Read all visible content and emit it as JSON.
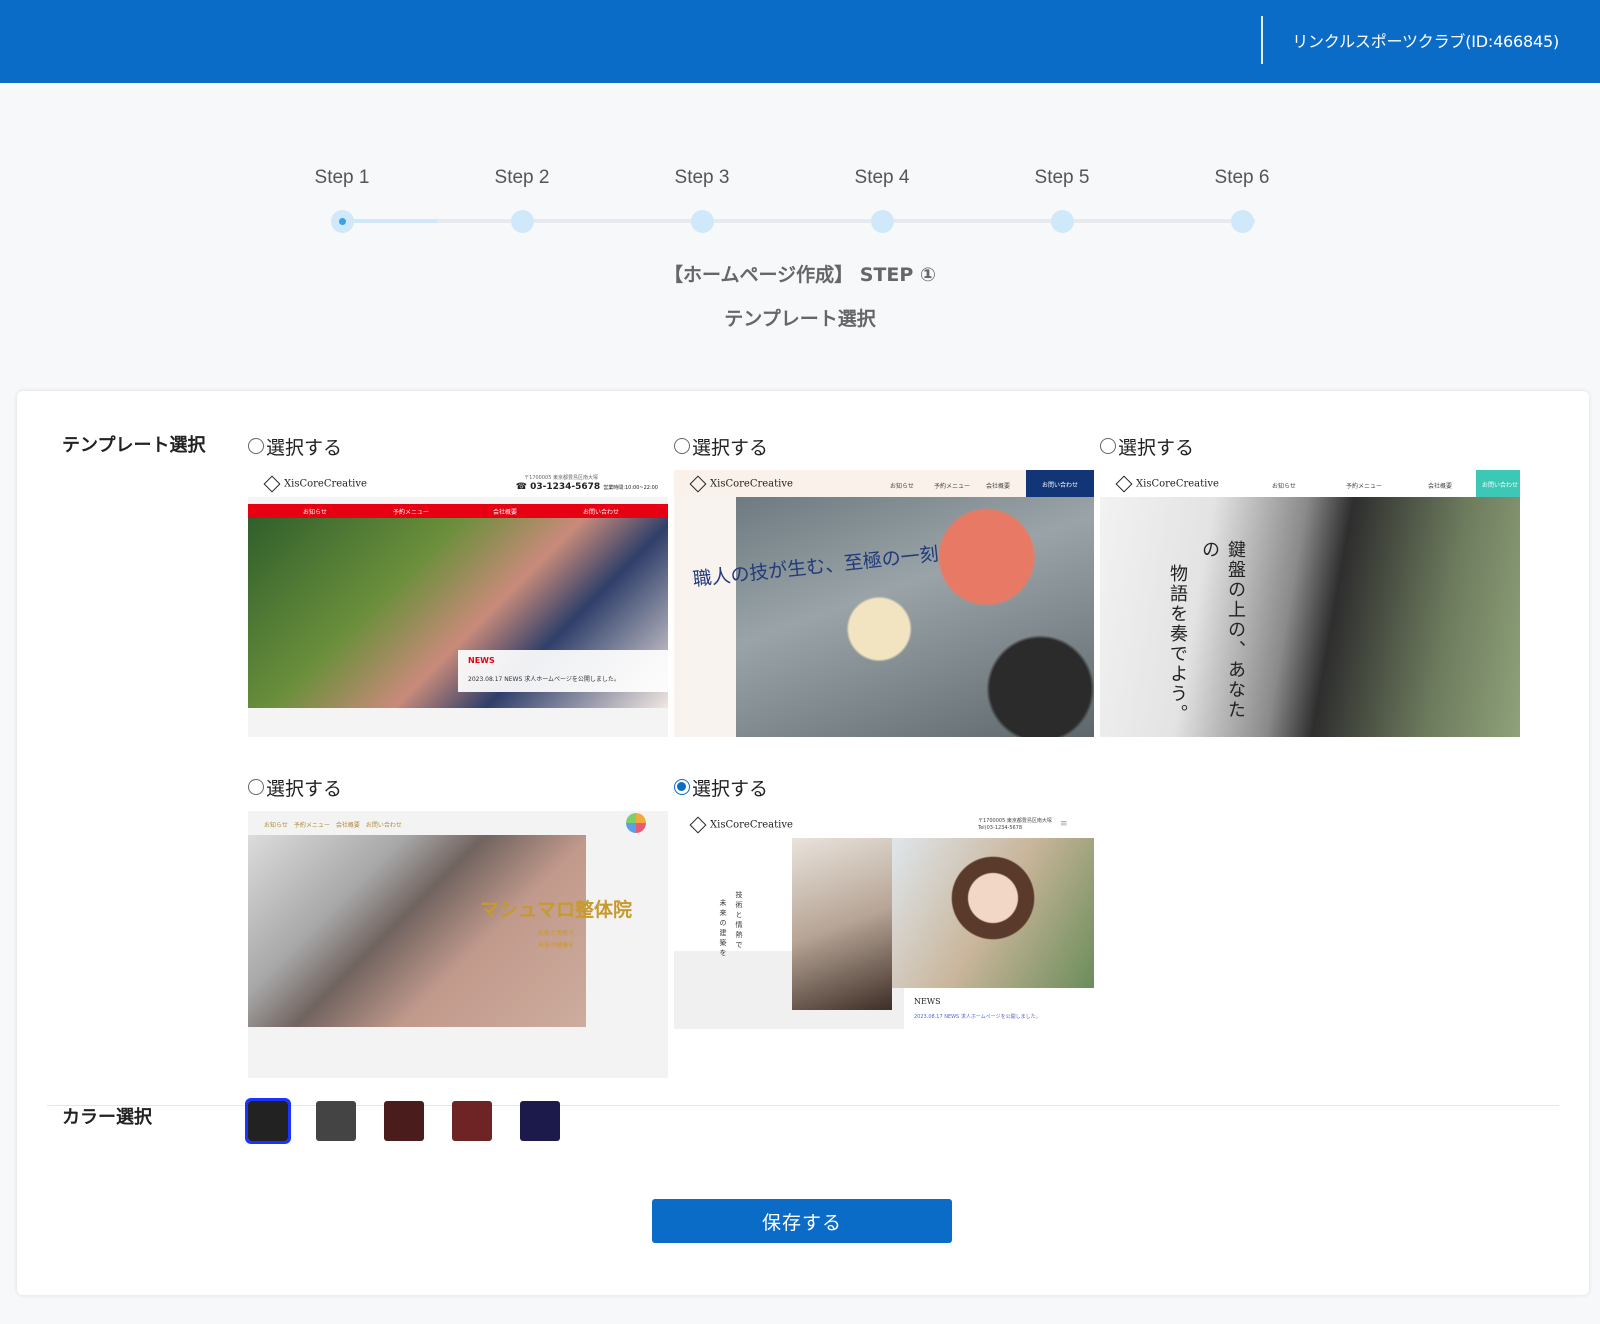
{
  "header": {
    "account": "リンクルスポーツクラブ(ID:466845)"
  },
  "stepper": {
    "steps": [
      "Step 1",
      "Step 2",
      "Step 3",
      "Step 4",
      "Step 5",
      "Step 6"
    ],
    "current_step": 1
  },
  "page": {
    "heading": "【ホームページ作成】 STEP ①",
    "subheading": "テンプレート選択"
  },
  "template_section": {
    "label": "テンプレート選択",
    "options": [
      {
        "radio_label": "選択する",
        "selected": false,
        "preview": {
          "logo": "XisCoreCreative",
          "address": "〒1700005 東京都豊島区南大塚",
          "tel": "03-1234-5678",
          "hours": "営業時間:10:00~22:00",
          "nav": [
            "お知らせ",
            "予約メニュー",
            "会社概要",
            "お問い合わせ"
          ],
          "news_title": "NEWS",
          "news_line": "2023.08.17 NEWS 求人ホームページを公開しました。"
        }
      },
      {
        "radio_label": "選択する",
        "selected": false,
        "preview": {
          "logo": "XisCoreCreative",
          "nav": [
            "お知らせ",
            "予約メニュー",
            "会社概要"
          ],
          "cta": "お問い合わせ",
          "catch": "職人の技が生む、至極の一刻"
        }
      },
      {
        "radio_label": "選択する",
        "selected": false,
        "preview": {
          "logo": "XisCoreCreative",
          "nav": [
            "お知らせ",
            "予約メニュー",
            "会社概要"
          ],
          "cta": "お問い合わせ",
          "catch_line1": "鍵盤の上の、あなたの",
          "catch_line2": "物語を奏でよう。"
        }
      },
      {
        "radio_label": "選択する",
        "selected": false,
        "preview": {
          "nav": "お知らせ　予約メニュー　会社概要　お問い合わせ",
          "brand": "マシュマロ整体院",
          "sub1": "技術と情熱で",
          "sub2": "未来の健康を"
        }
      },
      {
        "radio_label": "選択する",
        "selected": true,
        "preview": {
          "logo": "XisCoreCreative",
          "address": "〒1700005 東京都豊島区南大塚",
          "tel": "Tel)03-1234-5678",
          "vtext1": "技術と情熱で",
          "vtext2": "未来の建築を",
          "news_title": "NEWS",
          "news_line": "2023.08.17 NEWS 求人ホームページを公開しました。"
        }
      }
    ]
  },
  "color_section": {
    "label": "カラー選択",
    "swatches": [
      "#222222",
      "#444444",
      "#4a1c1c",
      "#6e2424",
      "#1c1a4a"
    ],
    "selected_index": 0
  },
  "actions": {
    "save_label": "保存する"
  },
  "colors": {
    "brand_blue": "#0b6cc8",
    "selection_outline": "#1a33ff"
  }
}
